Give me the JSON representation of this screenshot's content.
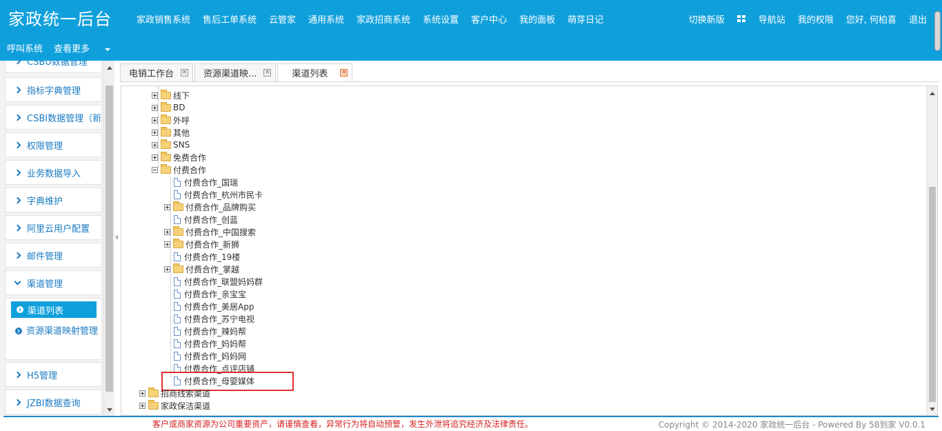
{
  "header": {
    "logo": "家政统一后台",
    "nav": [
      "家政销售系统",
      "售后工单系统",
      "云管家",
      "通用系统",
      "家政招商系统",
      "系统设置",
      "客户中心",
      "我的面板",
      "萌芽日记"
    ],
    "right": {
      "switch": "切换新版",
      "nav_site": "导航站",
      "perm": "我的权限",
      "greeting": "您好, 何柏喜",
      "logout": "退出"
    },
    "secondary": {
      "call": "呼叫系统",
      "more": "查看更多"
    }
  },
  "sidebar": {
    "top_partial": "CSBU数据管理",
    "items": [
      "指标字典管理",
      "CSBI数据管理（新",
      "权限管理",
      "业务数据导入",
      "字典维护",
      "阿里云用户配置",
      "邮件管理"
    ],
    "group": {
      "label": "渠道管理",
      "active": "渠道列表",
      "sub": "资源渠道映射管理"
    },
    "bottom_items": [
      "H5管理",
      "JZBI数据查询"
    ]
  },
  "tabs": [
    {
      "label": "电销工作台"
    },
    {
      "label": "资源渠道映..."
    },
    {
      "label": "渠道列表"
    }
  ],
  "tree": {
    "level1": [
      "线下",
      "BD",
      "外呼",
      "其他",
      "SNS",
      "免费合作",
      "付费合作"
    ],
    "children": [
      {
        "label": "付费合作_国瑞",
        "folder": false
      },
      {
        "label": "付费合作_杭州市民卡",
        "folder": false
      },
      {
        "label": "付费合作_品牌购买",
        "folder": true
      },
      {
        "label": "付费合作_创蓝",
        "folder": false
      },
      {
        "label": "付费合作_中国搜索",
        "folder": true
      },
      {
        "label": "付费合作_新狮",
        "folder": true
      },
      {
        "label": "付费合作_19楼",
        "folder": false
      },
      {
        "label": "付费合作_掌越",
        "folder": true
      },
      {
        "label": "付费合作_联盟妈妈群",
        "folder": false
      },
      {
        "label": "付费合作_亲宝宝",
        "folder": false
      },
      {
        "label": "付费合作_美居App",
        "folder": false
      },
      {
        "label": "付费合作_苏宁电视",
        "folder": false
      },
      {
        "label": "付费合作_辣妈帮",
        "folder": false
      },
      {
        "label": "付费合作_妈妈帮",
        "folder": false
      },
      {
        "label": "付费合作_妈妈网",
        "folder": false
      },
      {
        "label": "付费合作_点评店铺",
        "folder": false
      },
      {
        "label": "付费合作_母婴媒体",
        "folder": false
      }
    ],
    "root": [
      "招商线索渠道",
      "家政保洁渠道"
    ]
  },
  "footer": {
    "warning": "客户或商家资源为公司重要资产，请谨慎查看，异常行为将自动预警，发生外泄将追究经济及法律责任。",
    "copyright": "Copyright © 2014-2020 家政统一后台 - Powered By 58到家 V0.0.1"
  },
  "colors": {
    "header_bg": "#0fa0dc",
    "link": "#1a7bc2",
    "highlight_box": "#e0302a",
    "warning_text": "#d62020"
  }
}
